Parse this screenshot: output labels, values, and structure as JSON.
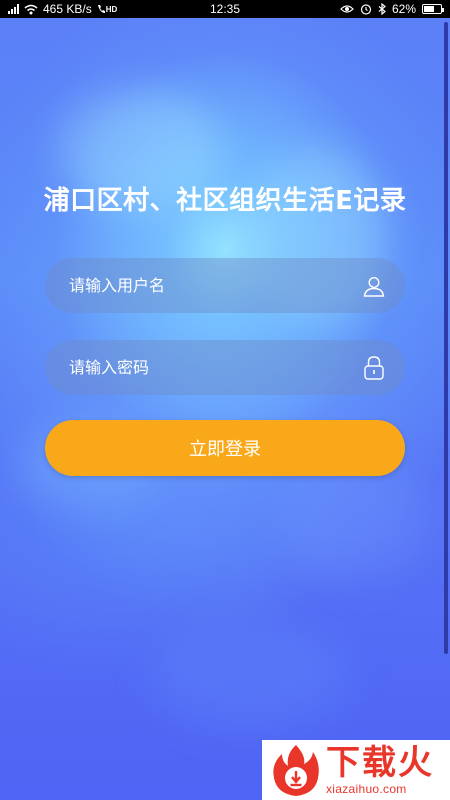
{
  "status_bar": {
    "network_speed": "465 KB/s",
    "hd_label": "HD",
    "time": "12:35",
    "battery_text": "62%",
    "battery_level": 0.62,
    "icons": [
      "signal-icon",
      "wifi-icon",
      "call-hd-icon",
      "eye-icon",
      "alarm-icon",
      "bluetooth-icon",
      "battery-icon"
    ]
  },
  "login": {
    "title": "浦口区村、社区组织生活E记录",
    "username_placeholder": "请输入用户名",
    "username_icon": "user-icon",
    "password_placeholder": "请输入密码",
    "password_icon": "lock-icon",
    "submit_label": "立即登录"
  },
  "watermark": {
    "cn": "下载火",
    "en": "xiazaihuo.com"
  },
  "colors": {
    "background": "#5a7ff7",
    "button": "#f9a81a",
    "field_bg": "rgba(110,140,200,0.45)",
    "watermark_red": "#e8362b"
  }
}
